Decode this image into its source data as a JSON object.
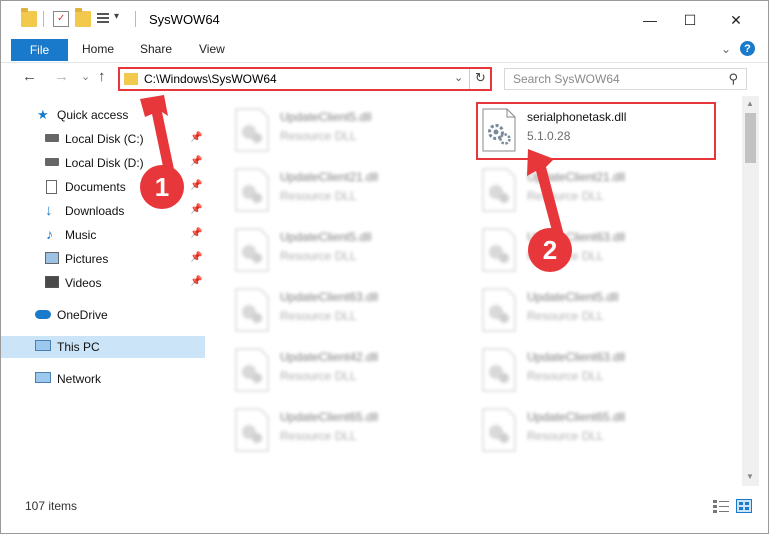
{
  "titlebar": {
    "title": "SysWOW64",
    "min_glyph": "—",
    "max_glyph": "☐",
    "close_glyph": "✕"
  },
  "ribbon": {
    "file": "File",
    "home": "Home",
    "share": "Share",
    "view": "View",
    "collapse_glyph": "⌄"
  },
  "nav": {
    "back_glyph": "←",
    "forward_glyph": "→",
    "recent_glyph": "⌄",
    "up_glyph": "↑",
    "address": "C:\\Windows\\SysWOW64",
    "dropdown_glyph": "⌄",
    "refresh_glyph": "↻",
    "search_placeholder": "Search SysWOW64",
    "search_glyph": "⚲"
  },
  "sidebar": {
    "items": [
      {
        "label": "Quick access",
        "pin": ""
      },
      {
        "label": "Local Disk (C:)",
        "pin": "📌"
      },
      {
        "label": "Local Disk (D:)",
        "pin": "📌"
      },
      {
        "label": "Documents",
        "pin": "📌"
      },
      {
        "label": "Downloads",
        "pin": "📌"
      },
      {
        "label": "Music",
        "pin": "📌"
      },
      {
        "label": "Pictures",
        "pin": "📌"
      },
      {
        "label": "Videos",
        "pin": "📌"
      },
      {
        "label": "OneDrive",
        "pin": ""
      },
      {
        "label": "This PC",
        "pin": ""
      },
      {
        "label": "Network",
        "pin": ""
      }
    ]
  },
  "files": {
    "left": [
      {
        "name": "UpdateClient5.dll",
        "type": "Resource DLL"
      },
      {
        "name": "UpdateClient21.dll",
        "type": "Resource DLL"
      },
      {
        "name": "UpdateClient5.dll",
        "type": "Resource DLL"
      },
      {
        "name": "UpdateClient63.dll",
        "type": "Resource DLL"
      },
      {
        "name": "UpdateClient42.dll",
        "type": "Resource DLL"
      },
      {
        "name": "UpdateClient65.dll",
        "type": "Resource DLL"
      }
    ],
    "right": [
      {
        "name": "serialphonetask.dll",
        "type": "5.1.0.28"
      },
      {
        "name": "UpdateClient21.dll",
        "type": "Resource DLL"
      },
      {
        "name": "UpdateClient63.dll",
        "type": "Resource DLL"
      },
      {
        "name": "UpdateClient5.dll",
        "type": "Resource DLL"
      },
      {
        "name": "UpdateClient63.dll",
        "type": "Resource DLL"
      },
      {
        "name": "UpdateClient65.dll",
        "type": "Resource DLL"
      }
    ]
  },
  "status": {
    "items": "107 items"
  },
  "callouts": {
    "one": "1",
    "two": "2"
  },
  "colors": {
    "accent": "#1979ca",
    "callout": "#e8373a",
    "selected": "#cce4f7"
  }
}
